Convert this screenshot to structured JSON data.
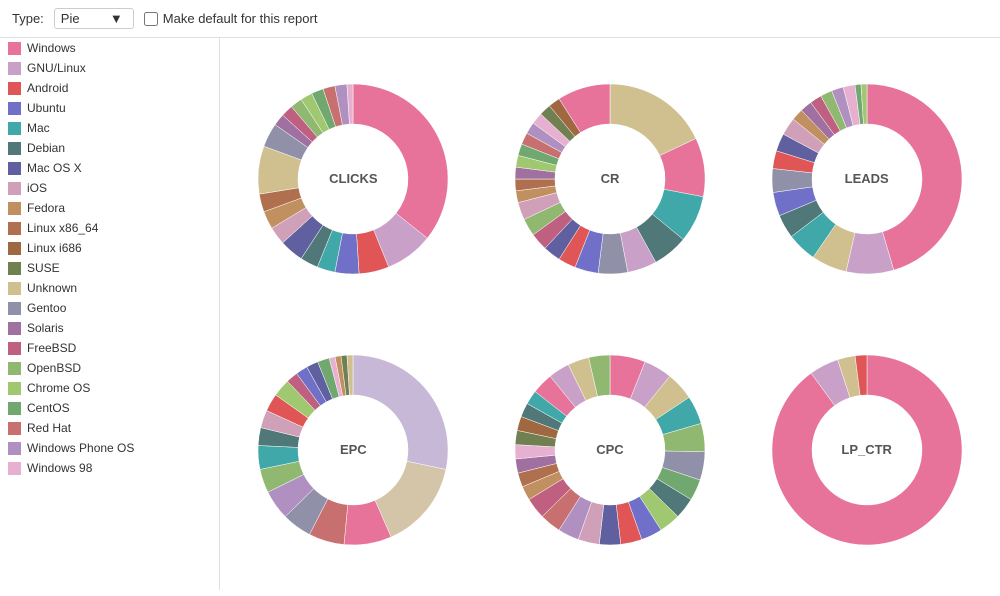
{
  "toolbar": {
    "type_label": "Type:",
    "type_value": "Pie",
    "dropdown_arrow": "▼",
    "make_default_label": "Make default for this report"
  },
  "legend": {
    "items": [
      {
        "label": "Windows",
        "color": "#e8739a"
      },
      {
        "label": "GNU/Linux",
        "color": "#c8a0c8"
      },
      {
        "label": "Android",
        "color": "#e05555"
      },
      {
        "label": "Ubuntu",
        "color": "#7070c8"
      },
      {
        "label": "Mac",
        "color": "#40a8a8"
      },
      {
        "label": "Debian",
        "color": "#507878"
      },
      {
        "label": "Mac OS X",
        "color": "#6060a0"
      },
      {
        "label": "iOS",
        "color": "#d0a0b8"
      },
      {
        "label": "Fedora",
        "color": "#c09060"
      },
      {
        "label": "Linux x86_64",
        "color": "#b07050"
      },
      {
        "label": "Linux i686",
        "color": "#a06840"
      },
      {
        "label": "SUSE",
        "color": "#708050"
      },
      {
        "label": "Unknown",
        "color": "#d0c090"
      },
      {
        "label": "Gentoo",
        "color": "#9090a8"
      },
      {
        "label": "Solaris",
        "color": "#a070a0"
      },
      {
        "label": "FreeBSD",
        "color": "#c06080"
      },
      {
        "label": "OpenBSD",
        "color": "#90b870"
      },
      {
        "label": "Chrome OS",
        "color": "#a0c870"
      },
      {
        "label": "CentOS",
        "color": "#70a870"
      },
      {
        "label": "Red Hat",
        "color": "#c87070"
      },
      {
        "label": "Windows Phone OS",
        "color": "#b090c0"
      },
      {
        "label": "Windows 98",
        "color": "#e8b0d0"
      }
    ]
  },
  "charts": [
    {
      "id": "clicks",
      "label": "CLICKS"
    },
    {
      "id": "cr",
      "label": "CR"
    },
    {
      "id": "leads",
      "label": "LEADS"
    },
    {
      "id": "epc",
      "label": "EPC"
    },
    {
      "id": "cpc",
      "label": "CPC"
    },
    {
      "id": "lp_ctr",
      "label": "LP_CTR"
    }
  ]
}
